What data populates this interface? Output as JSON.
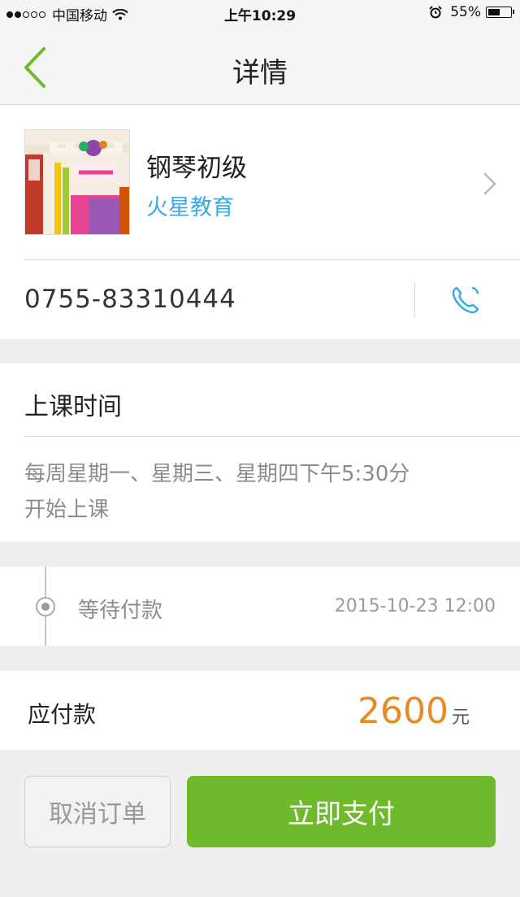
{
  "status_bar": {
    "carrier": "中国移动",
    "time": "上午10:29",
    "battery": "55%",
    "battery_level": 0.55,
    "signal_strength": 2,
    "signal_max": 5
  },
  "nav": {
    "title": "详情",
    "back_icon": "chevron-left-icon",
    "accent_color": "#6fba2c"
  },
  "shop": {
    "course_name": "钢琴初级",
    "shop_name": "火星教育",
    "phone": "0755-83310444",
    "phone_icon": "phone-icon",
    "shop_name_color": "#3ba9e4"
  },
  "schedule": {
    "title": "上课时间",
    "lines": [
      "每周星期一、星期三、星期四下午5:30分",
      "开始上课"
    ]
  },
  "order_status": {
    "label": "等待付款",
    "time": "2015-10-23 12:00"
  },
  "payment": {
    "label": "应付款",
    "amount": "2600",
    "unit": "元",
    "amount_color": "#e48b25"
  },
  "actions": {
    "cancel_label": "取消订单",
    "pay_label": "立即支付",
    "pay_color": "#6fba2c"
  }
}
